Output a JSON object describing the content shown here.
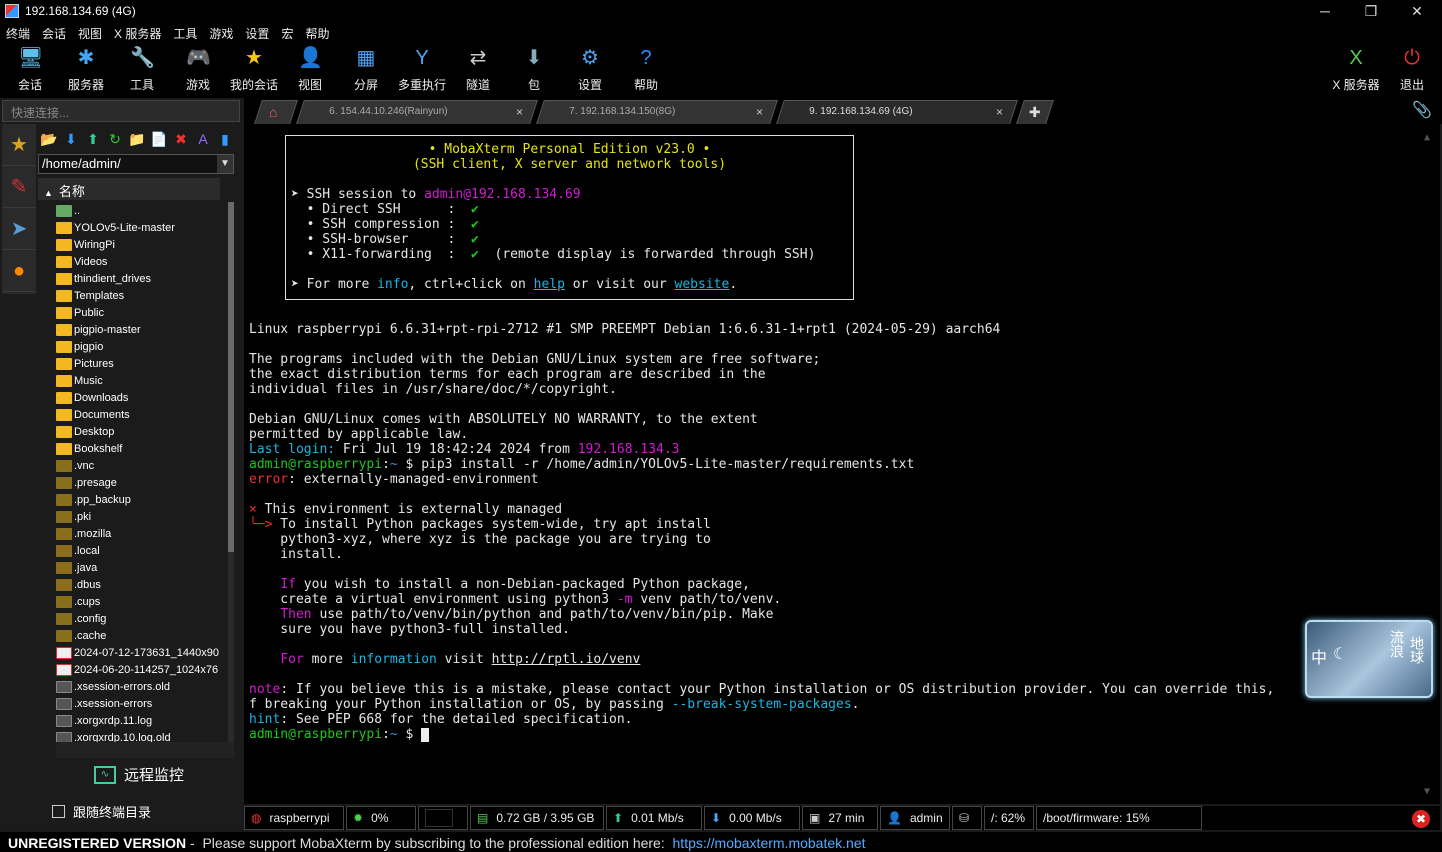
{
  "window": {
    "title": "192.168.134.69 (4G)",
    "minimize": "─",
    "maximize": "❐",
    "close": "✕"
  },
  "menu": [
    "终端",
    "会话",
    "视图",
    "X 服务器",
    "工具",
    "游戏",
    "设置",
    "宏",
    "帮助"
  ],
  "toolbar": [
    {
      "label": "会话",
      "icon": "session-icon",
      "glyph": "🖥",
      "color": "#5bc0eb"
    },
    {
      "label": "服务器",
      "icon": "servers-icon",
      "glyph": "✱",
      "color": "#3fa9f5"
    },
    {
      "label": "工具",
      "icon": "tools-icon",
      "glyph": "🔧",
      "color": "#e55"
    },
    {
      "label": "游戏",
      "icon": "games-icon",
      "glyph": "🎮",
      "color": "#ccc"
    },
    {
      "label": "我的会话",
      "icon": "star-icon",
      "glyph": "★",
      "color": "#f5c518"
    },
    {
      "label": "视图",
      "icon": "view-icon",
      "glyph": "👤",
      "color": "#ccc"
    },
    {
      "label": "分屏",
      "icon": "split-icon",
      "glyph": "▦",
      "color": "#4aa3f0"
    },
    {
      "label": "多重执行",
      "icon": "multiexec-icon",
      "glyph": "Y",
      "color": "#4aa3f0"
    },
    {
      "label": "隧道",
      "icon": "tunnel-icon",
      "glyph": "⇄",
      "color": "#ccc"
    },
    {
      "label": "包",
      "icon": "packages-icon",
      "glyph": "⬇",
      "color": "#8ab"
    },
    {
      "label": "设置",
      "icon": "settings-icon",
      "glyph": "⚙",
      "color": "#4aa3f0"
    },
    {
      "label": "帮助",
      "icon": "help-icon",
      "glyph": "?",
      "color": "#1e90ff"
    }
  ],
  "toolbar_right": [
    {
      "label": "X 服务器",
      "icon": "x-server-icon",
      "glyph": "X",
      "color": "#5c5"
    },
    {
      "label": "退出",
      "icon": "exit-icon",
      "glyph": "⏻",
      "color": "#e33"
    }
  ],
  "quick_connect": {
    "placeholder": "快速连接..."
  },
  "tabs": [
    {
      "label": "6. 154.44.10.246(Rainyun)",
      "close": "×"
    },
    {
      "label": "7. 192.168.134.150(8G)",
      "close": "×"
    },
    {
      "label": "9. 192.168.134.69 (4G)",
      "close": "×"
    }
  ],
  "sidebar": {
    "path": "/home/admin/",
    "column": "名称",
    "remote_monitor": "远程监控",
    "follow_terminal": "跟随终端目录",
    "files": [
      {
        "name": "..",
        "type": "up"
      },
      {
        "name": "YOLOv5-Lite-master",
        "type": "folder"
      },
      {
        "name": "WiringPi",
        "type": "folder"
      },
      {
        "name": "Videos",
        "type": "folder"
      },
      {
        "name": "thindient_drives",
        "type": "folder"
      },
      {
        "name": "Templates",
        "type": "folder"
      },
      {
        "name": "Public",
        "type": "folder"
      },
      {
        "name": "pigpio-master",
        "type": "folder"
      },
      {
        "name": "pigpio",
        "type": "folder"
      },
      {
        "name": "Pictures",
        "type": "folder"
      },
      {
        "name": "Music",
        "type": "folder"
      },
      {
        "name": "Downloads",
        "type": "folder"
      },
      {
        "name": "Documents",
        "type": "folder"
      },
      {
        "name": "Desktop",
        "type": "folder"
      },
      {
        "name": "Bookshelf",
        "type": "folder"
      },
      {
        "name": ".vnc",
        "type": "hidden"
      },
      {
        "name": ".presage",
        "type": "hidden"
      },
      {
        "name": ".pp_backup",
        "type": "hidden"
      },
      {
        "name": ".pki",
        "type": "hidden"
      },
      {
        "name": ".mozilla",
        "type": "hidden"
      },
      {
        "name": ".local",
        "type": "hidden"
      },
      {
        "name": ".java",
        "type": "hidden"
      },
      {
        "name": ".dbus",
        "type": "hidden"
      },
      {
        "name": ".cups",
        "type": "hidden"
      },
      {
        "name": ".config",
        "type": "hidden"
      },
      {
        "name": ".cache",
        "type": "hidden"
      },
      {
        "name": "2024-07-12-173631_1440x90",
        "type": "img"
      },
      {
        "name": "2024-06-20-114257_1024x76",
        "type": "img"
      },
      {
        "name": ".xsession-errors.old",
        "type": "doc"
      },
      {
        "name": ".xsession-errors",
        "type": "doc"
      },
      {
        "name": ".xorgxrdp.11.log",
        "type": "doc"
      },
      {
        "name": ".xorgxrdp.10.log.old",
        "type": "doc"
      }
    ]
  },
  "terminal": {
    "banner": [
      [
        {
          "t": "• MobaXterm Personal Edition v23.0 •",
          "c": "y"
        }
      ],
      [
        {
          "t": "(SSH client, X server and network tools)",
          "c": "y"
        }
      ],
      [],
      [
        {
          "t": "➤ SSH session to "
        },
        {
          "t": "admin@192.168.134.69",
          "c": "m"
        }
      ],
      [
        {
          "t": "  • Direct SSH      :  "
        },
        {
          "t": "✔",
          "c": "g"
        }
      ],
      [
        {
          "t": "  • SSH compression :  "
        },
        {
          "t": "✔",
          "c": "g"
        }
      ],
      [
        {
          "t": "  • SSH-browser     :  "
        },
        {
          "t": "✔",
          "c": "g"
        }
      ],
      [
        {
          "t": "  • X11-forwarding  :  "
        },
        {
          "t": "✔",
          "c": "g"
        },
        {
          "t": "  (remote display is forwarded through SSH)"
        }
      ],
      [],
      [
        {
          "t": "➤ For more "
        },
        {
          "t": "info",
          "c": "c"
        },
        {
          "t": ", ctrl+click on "
        },
        {
          "t": "help",
          "c": "c u"
        },
        {
          "t": " or visit our "
        },
        {
          "t": "website",
          "c": "c u"
        },
        {
          "t": "."
        }
      ]
    ],
    "lines": [
      [
        {
          "t": "Linux raspberrypi 6.6.31+rpt-rpi-2712 #1 SMP PREEMPT Debian 1:6.6.31-1+rpt1 (2024-05-29) aarch64"
        }
      ],
      [],
      [
        {
          "t": "The programs included with the Debian GNU/Linux system are free software;"
        }
      ],
      [
        {
          "t": "the exact distribution terms for each program are described in the"
        }
      ],
      [
        {
          "t": "individual files in /usr/share/doc/*/copyright."
        }
      ],
      [],
      [
        {
          "t": "Debian GNU/Linux comes with ABSOLUTELY NO WARRANTY, to the extent"
        }
      ],
      [
        {
          "t": "permitted by applicable law."
        }
      ],
      [
        {
          "t": "Last login: ",
          "c": "c"
        },
        {
          "t": "Fri Jul 19 18:42:24 2024 from "
        },
        {
          "t": "192.168.134.3",
          "c": "m"
        }
      ],
      [
        {
          "t": "admin@raspberrypi",
          "c": "g"
        },
        {
          "t": ":"
        },
        {
          "t": "~",
          "c": "b"
        },
        {
          "t": " $ pip3 install -r /home/admin/YOLOv5-Lite-master/requirements.txt"
        }
      ],
      [
        {
          "t": "error",
          "c": "r"
        },
        {
          "t": ": externally-managed-environment"
        }
      ],
      [],
      [
        {
          "t": "×",
          "c": "r"
        },
        {
          "t": " This environment is externally managed"
        }
      ],
      [
        {
          "t": "╰─>",
          "c": "r"
        },
        {
          "t": " To install Python packages system-wide, try apt install"
        }
      ],
      [
        {
          "t": "    python3-xyz, where xyz is the package you are trying to"
        }
      ],
      [
        {
          "t": "    install."
        }
      ],
      [],
      [
        {
          "t": "    "
        },
        {
          "t": "If",
          "c": "m"
        },
        {
          "t": " you wish to install a non-Debian-packaged Python package,"
        }
      ],
      [
        {
          "t": "    create a virtual environment using python3 "
        },
        {
          "t": "-m",
          "c": "m"
        },
        {
          "t": " venv path/to/venv."
        }
      ],
      [
        {
          "t": "    "
        },
        {
          "t": "Then",
          "c": "m"
        },
        {
          "t": " use path/to/venv/bin/python and path/to/venv/bin/pip. Make"
        }
      ],
      [
        {
          "t": "    sure you have python3-full installed."
        }
      ],
      [],
      [
        {
          "t": "    "
        },
        {
          "t": "For",
          "c": "m"
        },
        {
          "t": " more "
        },
        {
          "t": "information",
          "c": "c"
        },
        {
          "t": " visit "
        },
        {
          "t": "http://rptl.io/venv",
          "c": "u"
        }
      ],
      [],
      [
        {
          "t": "note",
          "c": "m"
        },
        {
          "t": ": If you believe this is a mistake, please contact your Python installation or OS distribution provider. You can override this, "
        }
      ],
      [
        {
          "t": "f breaking your Python installation or OS, by passing "
        },
        {
          "t": "--break-system-packages",
          "c": "c"
        },
        {
          "t": "."
        }
      ],
      [
        {
          "t": "hint",
          "c": "c"
        },
        {
          "t": ": See PEP 668 for the detailed specification."
        }
      ],
      [
        {
          "t": "admin@raspberrypi",
          "c": "g"
        },
        {
          "t": ":"
        },
        {
          "t": "~",
          "c": "b"
        },
        {
          "t": " $ "
        },
        {
          "cursor": true
        }
      ]
    ]
  },
  "overlay": {
    "chars": [
      "中",
      "☾",
      "流浪",
      "地球"
    ]
  },
  "statusbar": [
    {
      "icon": "raspberry-icon",
      "glyph": "◍",
      "color": "#e33",
      "text": "raspberrypi"
    },
    {
      "icon": "cpu-icon",
      "glyph": "✹",
      "color": "#5c5",
      "text": "0%"
    },
    {
      "icon": "graph-icon",
      "glyph": "",
      "color": "#000",
      "text": ""
    },
    {
      "icon": "memory-icon",
      "glyph": "▤",
      "color": "#5c5",
      "text": "0.72 GB / 3.95 GB"
    },
    {
      "icon": "upload-icon",
      "glyph": "⬆",
      "color": "#3c9",
      "text": "0.01 Mb/s"
    },
    {
      "icon": "download-icon",
      "glyph": "⬇",
      "color": "#4af",
      "text": "0.00 Mb/s"
    },
    {
      "icon": "uptime-icon",
      "glyph": "▣",
      "color": "#ccc",
      "text": "27 min"
    },
    {
      "icon": "user-icon",
      "glyph": "👤",
      "color": "#ccc",
      "text": "admin"
    },
    {
      "icon": "disk-icon",
      "glyph": "⛁",
      "color": "#ccc",
      "text": ""
    },
    {
      "icon": "",
      "glyph": "",
      "color": "#ccc",
      "text": "/: 62%"
    },
    {
      "icon": "",
      "glyph": "",
      "color": "#ccc",
      "text": "/boot/firmware: 15%"
    }
  ],
  "footer": {
    "unregistered": "UNREGISTERED VERSION",
    "message": " -  Please support MobaXterm by subscribing to the professional edition here:  ",
    "link": "https://mobaxterm.mobatek.net"
  }
}
